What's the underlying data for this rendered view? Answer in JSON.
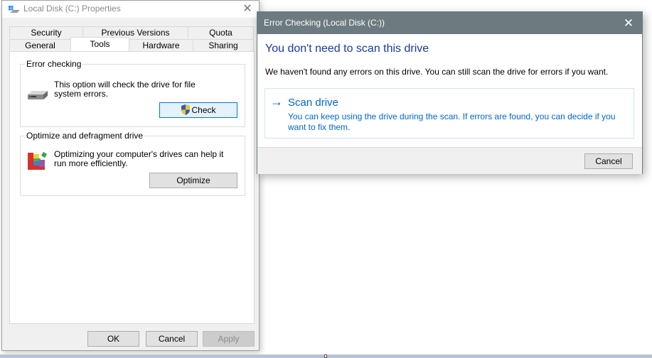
{
  "properties_dialog": {
    "title": "Local Disk (C:) Properties",
    "close_label": "✕",
    "tabs_back": [
      "Security",
      "Previous Versions",
      "Quota"
    ],
    "tabs_front": [
      "General",
      "Tools",
      "Hardware",
      "Sharing"
    ],
    "selected_tab": "Tools",
    "error_checking": {
      "legend": "Error checking",
      "description": "This option will check the drive for file system errors.",
      "button_label": "Check"
    },
    "optimize": {
      "legend": "Optimize and defragment drive",
      "description": "Optimizing your computer's drives can help it run more efficiently.",
      "button_label": "Optimize"
    },
    "footer": {
      "ok_label": "OK",
      "cancel_label": "Cancel",
      "apply_label": "Apply"
    }
  },
  "error_checking_dialog": {
    "title": "Error Checking (Local Disk (C:))",
    "close_label": "✕",
    "heading": "You don't need to scan this drive",
    "message": "We haven't found any errors on this drive. You can still scan the drive for errors if you want.",
    "scan_option": {
      "arrow": "→",
      "label": "Scan drive",
      "description": "You can keep using the drive during the scan. If errors are found, you can decide if you want to fix them."
    },
    "cancel_label": "Cancel"
  },
  "colors": {
    "accent_blue": "#0066cc",
    "heading_blue": "#1a3a9c",
    "title_bar": "#6d7b80"
  }
}
